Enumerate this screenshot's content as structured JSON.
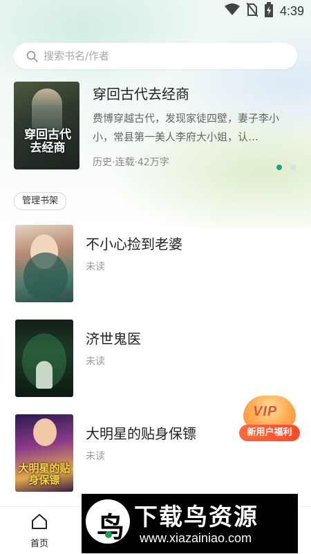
{
  "status_bar": {
    "time": "4:39",
    "icons": [
      "wifi-icon",
      "no-sim-icon",
      "battery-charging-icon"
    ]
  },
  "search": {
    "placeholder": "搜索书名/作者",
    "icon": "search-icon"
  },
  "featured_book": {
    "cover_text": "穿回古代去经商",
    "title": "穿回古代去经商",
    "description": "费博穿越古代，发现家徒四壁，妻子李小小，常县第一美人李府大小姐，认…",
    "meta": "历史·连载·42万字"
  },
  "carousel": {
    "total": 2,
    "active_index": 0
  },
  "bookshelf": {
    "manage_label": "管理书架",
    "books": [
      {
        "title": "不小心捡到老婆",
        "status": "未读"
      },
      {
        "title": "济世鬼医",
        "status": "未读"
      },
      {
        "title": "大明星的贴身保镖",
        "status": "未读",
        "cover_text": "大明星的贴身保镖"
      }
    ]
  },
  "vip_badge": {
    "badge_text": "VIP",
    "label": "新用户福利"
  },
  "tab_bar": {
    "home_label": "首页",
    "home_icon": "home-icon"
  },
  "watermark": {
    "title": "下载鸟资源",
    "url": "www.xiazainiao.com"
  },
  "colors": {
    "accent": "#1fa187",
    "vip": "#ff4a2a"
  }
}
